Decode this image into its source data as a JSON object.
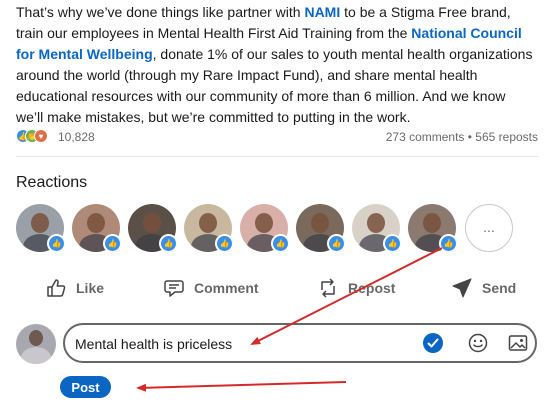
{
  "post": {
    "text_1": "That’s why we’ve done things like partner with ",
    "link_nami": "NAMI",
    "text_2": " to be a Stigma Free brand, train our employees in Mental Health First Aid Training from the ",
    "link_council": "National Council for Mental Wellbeing",
    "text_3": ", donate 1% of our sales to youth mental health organizations around the world (through my Rare Impact Fund), and share mental health educational resources with our community of more than 6 million. And we know we’ll make mistakes, but we’re committed to putting in the work."
  },
  "social": {
    "reactions_count": "10,828",
    "comments_reposts": "273 comments • 565 reposts"
  },
  "reactions": {
    "heading": "Reactions",
    "more_label": "...",
    "avatar_colors": [
      "#9aa0a8",
      "#b08a78",
      "#5a5048",
      "#c9b8a0",
      "#d8b0a8",
      "#7a6a5e",
      "#d9d0c8",
      "#8a7a70"
    ]
  },
  "actions": {
    "like": "Like",
    "comment": "Comment",
    "repost": "Repost",
    "send": "Send"
  },
  "comment": {
    "value": "Mental health is priceless",
    "post_label": "Post"
  },
  "colors": {
    "accent": "#0a66c2",
    "annotation_arrow": "#d42a2a"
  }
}
